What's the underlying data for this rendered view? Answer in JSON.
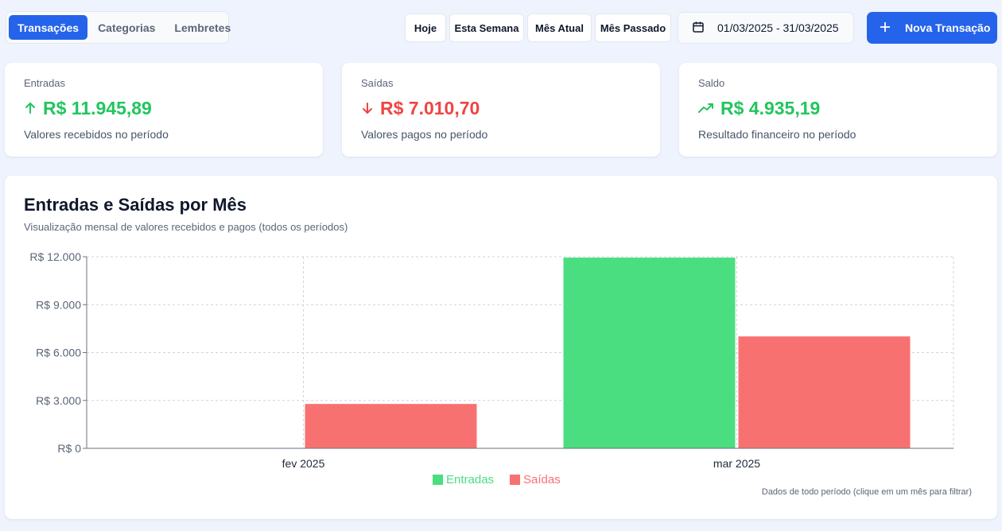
{
  "tabs": [
    {
      "label": "Transações",
      "active": true
    },
    {
      "label": "Categorias",
      "active": false
    },
    {
      "label": "Lembretes",
      "active": false
    }
  ],
  "quick_filters": [
    "Hoje",
    "Esta Semana",
    "Mês Atual",
    "Mês Passado"
  ],
  "date_range": "01/03/2025 - 31/03/2025",
  "new_button": "Nova Transação",
  "cards": [
    {
      "label": "Entradas",
      "value": "R$ 11.945,89",
      "sub": "Valores recebidos no período",
      "color": "#22c55e",
      "icon": "arrow-up-icon"
    },
    {
      "label": "Saídas",
      "value": "R$ 7.010,70",
      "sub": "Valores pagos no período",
      "color": "#ef4444",
      "icon": "arrow-down-icon"
    },
    {
      "label": "Saldo",
      "value": "R$ 4.935,19",
      "sub": "Resultado financeiro no período",
      "color": "#22c55e",
      "icon": "trending-up-icon"
    }
  ],
  "chart_panel": {
    "title": "Entradas e Saídas por Mês",
    "subtitle": "Visualização mensal de valores recebidos e pagos (todos os períodos)",
    "note": "Dados de todo período (clique em um mês para filtrar)"
  },
  "colors": {
    "accent": "#2563eb",
    "entradas": "#4ade80",
    "saidas": "#f87171"
  },
  "chart_data": {
    "type": "bar",
    "categories": [
      "fev 2025",
      "mar 2025"
    ],
    "series": [
      {
        "name": "Entradas",
        "values": [
          0,
          11945.89
        ],
        "color": "#4ade80"
      },
      {
        "name": "Saídas",
        "values": [
          2780,
          7010.7
        ],
        "color": "#f87171"
      }
    ],
    "ylim": [
      0,
      12000
    ],
    "yticks": [
      0,
      3000,
      6000,
      9000,
      12000
    ],
    "ytick_labels": [
      "R$ 0",
      "R$ 3.000",
      "R$ 6.000",
      "R$ 9.000",
      "R$ 12.000"
    ],
    "grid": true,
    "legend": "bottom"
  }
}
